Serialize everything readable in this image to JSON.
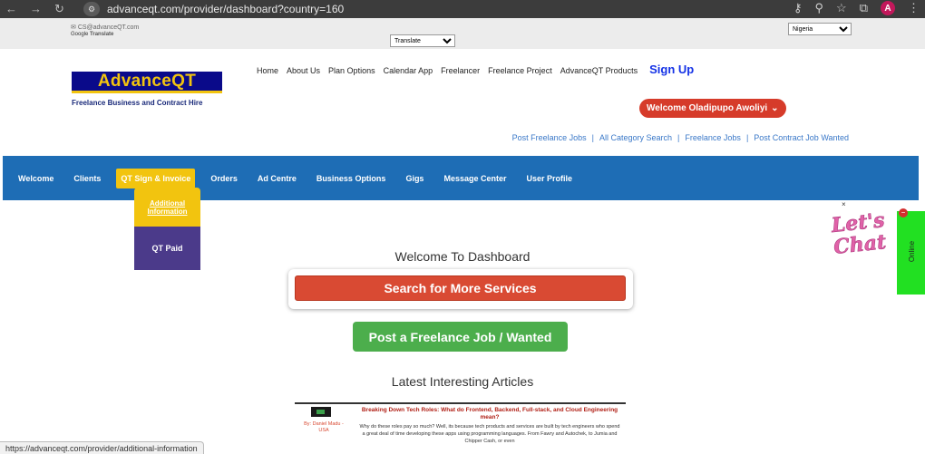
{
  "browser": {
    "url": "advanceqt.com/provider/dashboard?country=160",
    "avatar_letter": "A"
  },
  "utilbar": {
    "email": "CS@advanceQT.com",
    "google": "Google",
    "translate_label": "Translate",
    "translate_select": "Translate",
    "country_select": "Nigeria"
  },
  "header": {
    "logo": "AdvanceQT",
    "tagline": "Freelance Business and Contract Hire",
    "topnav": [
      "Home",
      "About Us",
      "Plan Options",
      "Calendar App",
      "Freelancer",
      "Freelance Project",
      "AdvanceQT Products"
    ],
    "signup": "Sign Up",
    "welcome": "Welcome Oladipupo Awoliyi",
    "sublinks": [
      "Post Freelance Jobs",
      "All Category Search",
      "Freelance Jobs",
      "Post Contract Job Wanted"
    ]
  },
  "mainnav": [
    "Welcome",
    "Clients",
    "QT Sign & Invoice",
    "Orders",
    "Ad Centre",
    "Business Options",
    "Gigs",
    "Message Center",
    "User Profile"
  ],
  "dropdown": {
    "item1_line1": "Additional",
    "item1_line2": "Information",
    "item2": "QT Paid"
  },
  "main": {
    "dashboard_title": "Welcome To Dashboard",
    "search_button": "Search for More Services",
    "post_button": "Post a Freelance Job / Wanted",
    "articles_title": "Latest Interesting Articles"
  },
  "article": {
    "author": "By: Daniel Madu - USA",
    "title": "Breaking Down Tech Roles: What do Frontend, Backend, Full-stack, and Cloud Engineering mean?",
    "body": "Why do these roles pay so much? Well, its because tech products and services are built by tech engineers who spend a great deal of time developing these apps using programming languages. From Fawry and Autochek, to Jumia and Chipper Cash, or even"
  },
  "status_url": "https://advanceqt.com/provider/additional-information",
  "chat": {
    "text_line1": "Let's",
    "text_line2": "Chat",
    "close": "×",
    "online": "Online",
    "badge": "−"
  },
  "colors": {
    "nav_blue": "#1e6db5",
    "accent_yellow": "#f2c40f",
    "search_red": "#d94a33",
    "post_green": "#4cae4c"
  }
}
